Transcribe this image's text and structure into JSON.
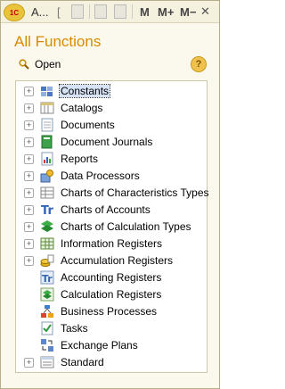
{
  "titlebar": {
    "app_text": "A...",
    "bracket": "[",
    "m": "M",
    "m_plus": "M+",
    "m_minus": "M−"
  },
  "heading": "All Functions",
  "open_label": "Open",
  "help_label": "?",
  "tree": [
    {
      "label": "Constants",
      "expandable": true,
      "selected": true,
      "icon": "constants-icon"
    },
    {
      "label": "Catalogs",
      "expandable": true,
      "icon": "catalogs-icon"
    },
    {
      "label": "Documents",
      "expandable": true,
      "icon": "documents-icon"
    },
    {
      "label": "Document Journals",
      "expandable": true,
      "icon": "document-journals-icon"
    },
    {
      "label": "Reports",
      "expandable": true,
      "icon": "reports-icon"
    },
    {
      "label": "Data Processors",
      "expandable": true,
      "icon": "data-processors-icon"
    },
    {
      "label": "Charts of Characteristics Types",
      "expandable": true,
      "icon": "characteristics-icon"
    },
    {
      "label": "Charts of Accounts",
      "expandable": true,
      "icon": "accounts-icon"
    },
    {
      "label": "Charts of Calculation Types",
      "expandable": true,
      "icon": "calculation-types-icon"
    },
    {
      "label": "Information Registers",
      "expandable": true,
      "icon": "information-registers-icon"
    },
    {
      "label": "Accumulation Registers",
      "expandable": true,
      "icon": "accumulation-registers-icon"
    },
    {
      "label": "Accounting Registers",
      "expandable": false,
      "icon": "accounting-registers-icon"
    },
    {
      "label": "Calculation Registers",
      "expandable": false,
      "icon": "calculation-registers-icon"
    },
    {
      "label": "Business Processes",
      "expandable": false,
      "icon": "business-processes-icon"
    },
    {
      "label": "Tasks",
      "expandable": false,
      "icon": "tasks-icon"
    },
    {
      "label": "Exchange Plans",
      "expandable": false,
      "icon": "exchange-plans-icon"
    },
    {
      "label": "Standard",
      "expandable": true,
      "icon": "standard-icon"
    }
  ],
  "colors": {
    "heading": "#d88a00",
    "selection": "#d6e3f7"
  }
}
